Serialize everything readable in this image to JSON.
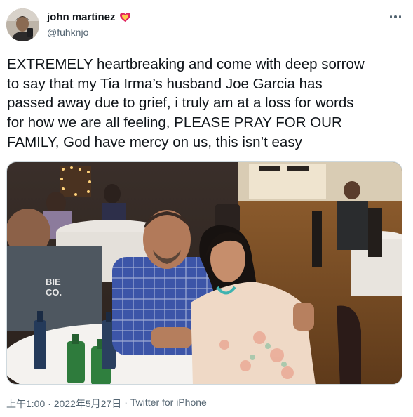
{
  "author": {
    "display_name": "john martinez",
    "handle": "@fuhknjo",
    "avatar_icon": "profile-photo",
    "name_badge_icon": "heart-emoji-icon"
  },
  "tweet": {
    "text": "EXTREMELY heartbreaking and come with deep sorrow\nto say that my Tia Irma’s husband Joe Garcia has\npassed away due to grief, i truly am at a loss for words\nfor how we are all feeling, PLEASE PRAY FOR OUR\nFAMILY, God have mercy on us, this isn’t easy",
    "media": {
      "kind": "photo",
      "alt_icon": "photo-couple-at-party"
    }
  },
  "meta": {
    "timestamp": "上午1:00 · 2022年5月27日",
    "separator": "·",
    "source": "Twitter for iPhone"
  },
  "actions": {
    "more_icon": "more-options-icon"
  },
  "colors": {
    "text_primary": "#0f1419",
    "text_secondary": "#536471",
    "border": "#cfd9de"
  }
}
